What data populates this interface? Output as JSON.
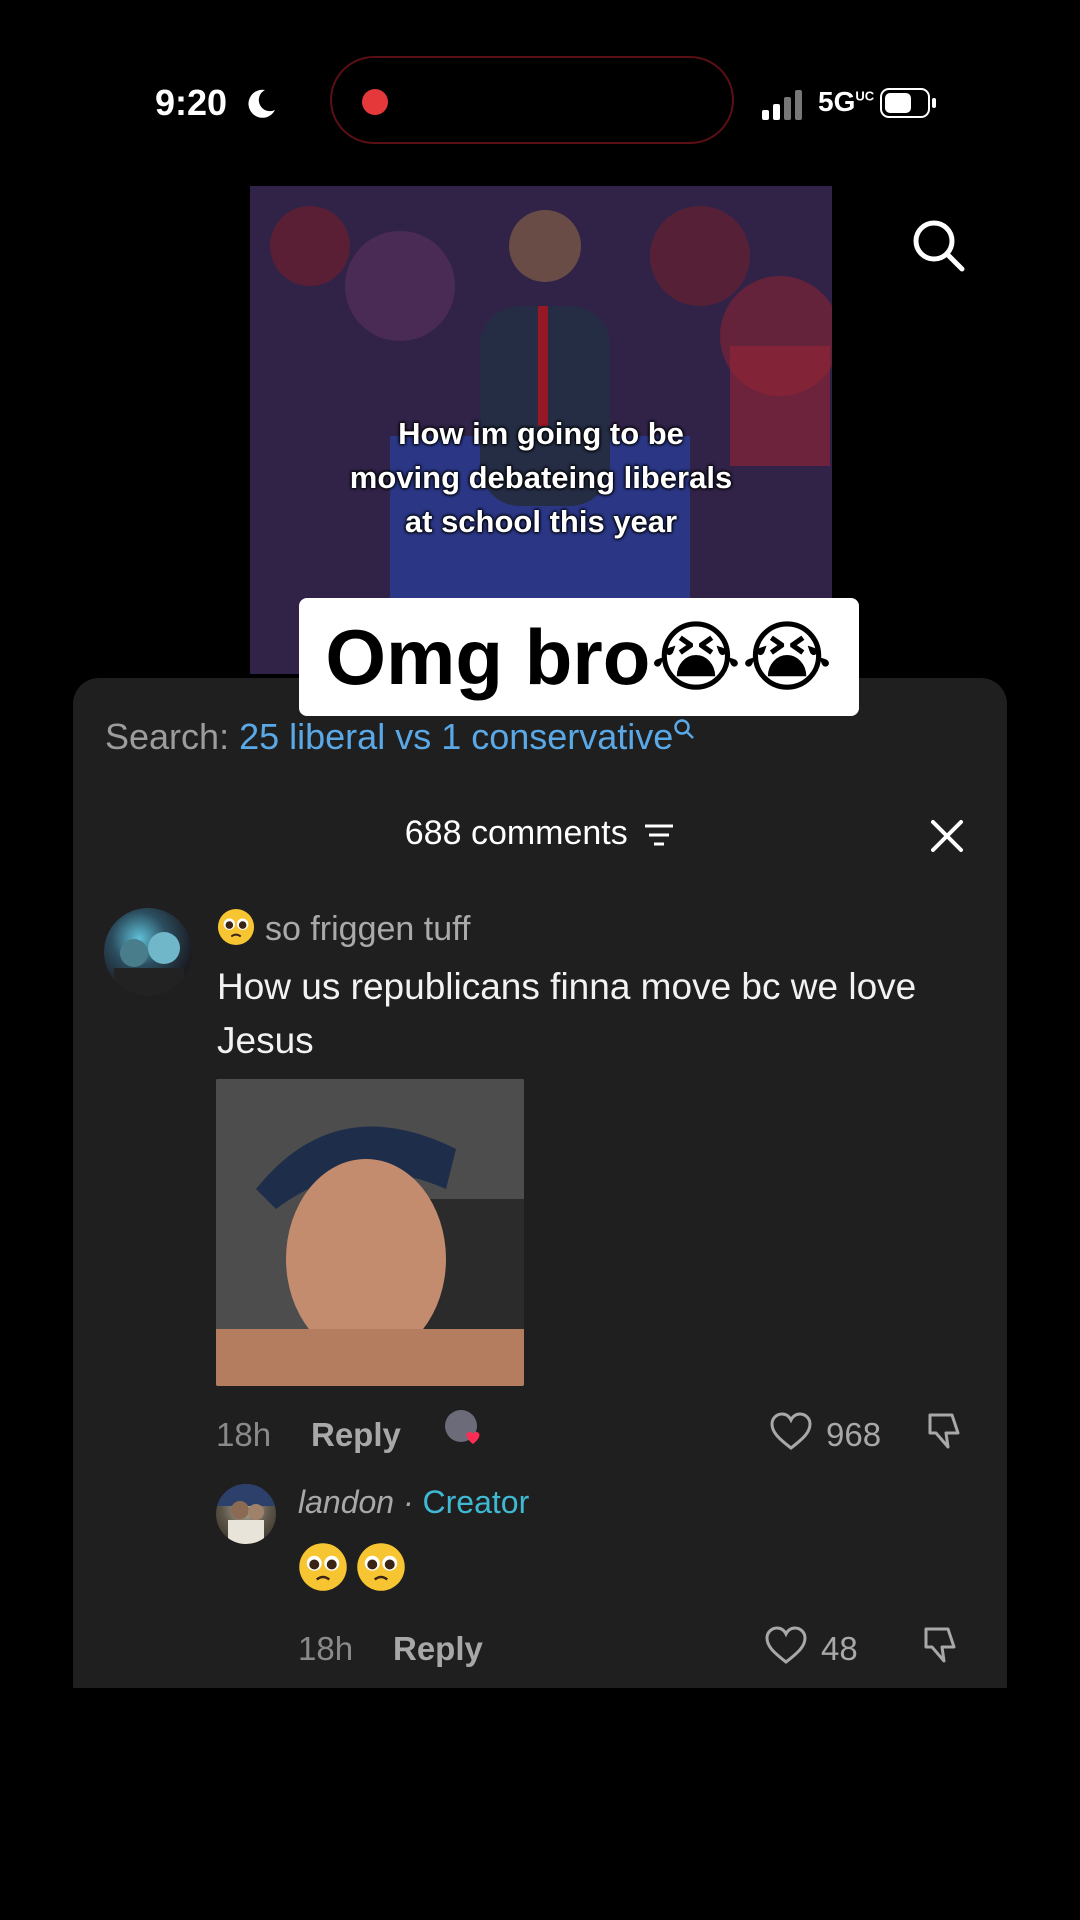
{
  "status_bar": {
    "time": "9:20",
    "network": "5G",
    "network_sup": "UC"
  },
  "video": {
    "caption_lines": [
      "How im going to be",
      "moving debateing liberals",
      "at school this year"
    ]
  },
  "sticker_text": "Omg bro😭😭",
  "comments_sheet": {
    "search_label": "Search:",
    "search_query": "25 liberal vs 1 conservative",
    "comment_count": "688 comments",
    "comment": {
      "username": "so friggen tuff",
      "text": "How us republicans finna move bc we love Jesus",
      "time": "18h",
      "reply_label": "Reply",
      "likes": "968"
    },
    "reply": {
      "username": "landon",
      "separator": " · ",
      "badge": "Creator",
      "time": "18h",
      "reply_label": "Reply",
      "likes": "48"
    }
  },
  "colors": {
    "accent_link": "#5aa9e6",
    "creator_badge": "#3fb9d3",
    "sheet_bg": "#1f1f1f"
  },
  "icons": [
    "moon-icon",
    "signal-icon",
    "battery-icon",
    "search-icon",
    "sort-icon",
    "close-icon",
    "heart-icon",
    "dislike-icon",
    "pleading-face-emoji"
  ]
}
